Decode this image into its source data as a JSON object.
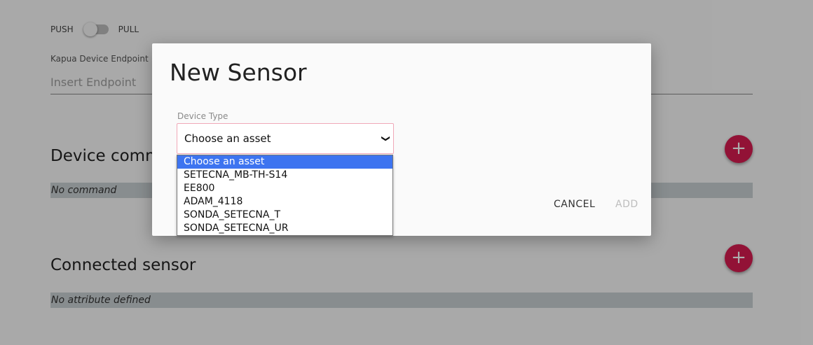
{
  "background": {
    "toggle": {
      "left_label": "PUSH",
      "right_label": "PULL"
    },
    "endpoint": {
      "label": "Kapua Device Endpoint",
      "placeholder": "Insert Endpoint"
    },
    "commands_section": {
      "title": "Device comm",
      "empty_text": "No command"
    },
    "sensors_section": {
      "title": "Connected sensor",
      "empty_text": "No attribute defined"
    },
    "add_icon": "+"
  },
  "dialog": {
    "title": "New Sensor",
    "device_type": {
      "label": "Device Type",
      "selected": "Choose an asset",
      "chevron": "❯",
      "options": [
        "Choose an asset",
        "SETECNA_MB-TH-S14",
        "EE800",
        "ADAM_4118",
        "SONDA_SETECNA_T",
        "SONDA_SETECNA_UR"
      ]
    },
    "cancel_label": "CANCEL",
    "add_label": "ADD"
  },
  "colors": {
    "accent": "#d81b50",
    "selection": "#3d74f0",
    "empty_bar": "#c9d0d3"
  }
}
